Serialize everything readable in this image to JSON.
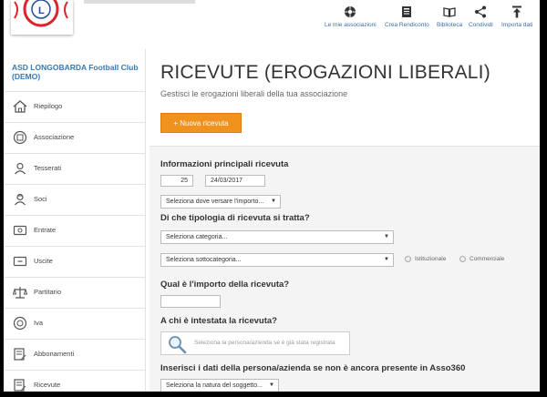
{
  "toolbar": {
    "items": [
      {
        "label": "Le mie associazioni",
        "icon": "associations-icon"
      },
      {
        "label": "Crea Rendiconto",
        "icon": "report-icon"
      },
      {
        "label": "Biblioteca",
        "icon": "library-icon"
      },
      {
        "label": "Condividi",
        "icon": "share-icon"
      },
      {
        "label": "Importa dati",
        "icon": "import-icon"
      }
    ]
  },
  "sidebar": {
    "club_name": "ASD LONGOBARDA Football Club (DEMO)",
    "items": [
      {
        "label": "Riepilogo",
        "icon": "home-icon"
      },
      {
        "label": "Associazione",
        "icon": "building-icon"
      },
      {
        "label": "Tesserati",
        "icon": "person-card-icon"
      },
      {
        "label": "Soci",
        "icon": "member-icon"
      },
      {
        "label": "Entrate",
        "icon": "income-icon"
      },
      {
        "label": "Uscite",
        "icon": "expense-icon"
      },
      {
        "label": "Partitario",
        "icon": "balance-icon"
      },
      {
        "label": "Iva",
        "icon": "vat-icon"
      },
      {
        "label": "Abbonamenti",
        "icon": "subscription-icon"
      },
      {
        "label": "Ricevute",
        "icon": "receipt-icon"
      }
    ]
  },
  "main": {
    "title": "RICEVUTE (EROGAZIONI LIBERALI)",
    "subtitle": "Gestisci le erogazioni liberali della tua associazione",
    "new_button": "+ Nuova ricevuta",
    "form": {
      "section_info": "Informazioni principali ricevuta",
      "number_value": "25",
      "date_value": "24/03/2017",
      "payment_select": "Seleziona dove versare l'importo...",
      "section_type": "Di che tipologia di ricevuta si tratta?",
      "category_select": "Seleziona categoria...",
      "subcategory_select": "Seleziona sottocategoria...",
      "radio_institutional": "Istituzionale",
      "radio_commercial": "Commerciale",
      "section_amount": "Qual è l'importo della ricevuta?",
      "amount_value": "",
      "section_recipient": "A chi è intestata la ricevuta?",
      "search_placeholder": "Seleziona la persona/azienda se è già stata registrata",
      "section_new_person": "Inserisci i dati della persona/azienda se non è ancora presente in Asso360",
      "nature_select": "Seleziona la natura del soggetto..."
    }
  },
  "colors": {
    "accent": "#f0921e",
    "link": "#337ab7",
    "logo_red": "#d9262b",
    "logo_blue": "#1f4f9a"
  }
}
